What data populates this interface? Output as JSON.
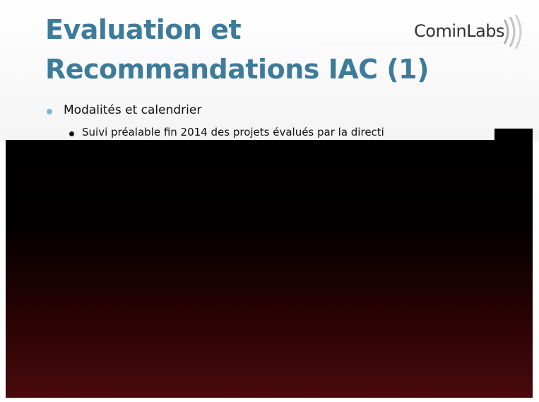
{
  "slide": {
    "title_line1": "Evaluation et",
    "title_line2": "Recommandations IAC (1)",
    "logo_text": "CominLabs",
    "bullets": [
      {
        "text": "Modalités et calendrier"
      },
      {
        "text": "Suivi préalable fin 2014 des projets évalués par la directi"
      }
    ]
  },
  "colors": {
    "title": "#3e7b9a",
    "accent_bullet": "#7fb6d3",
    "dark_bottom": "#4a0a0c"
  }
}
